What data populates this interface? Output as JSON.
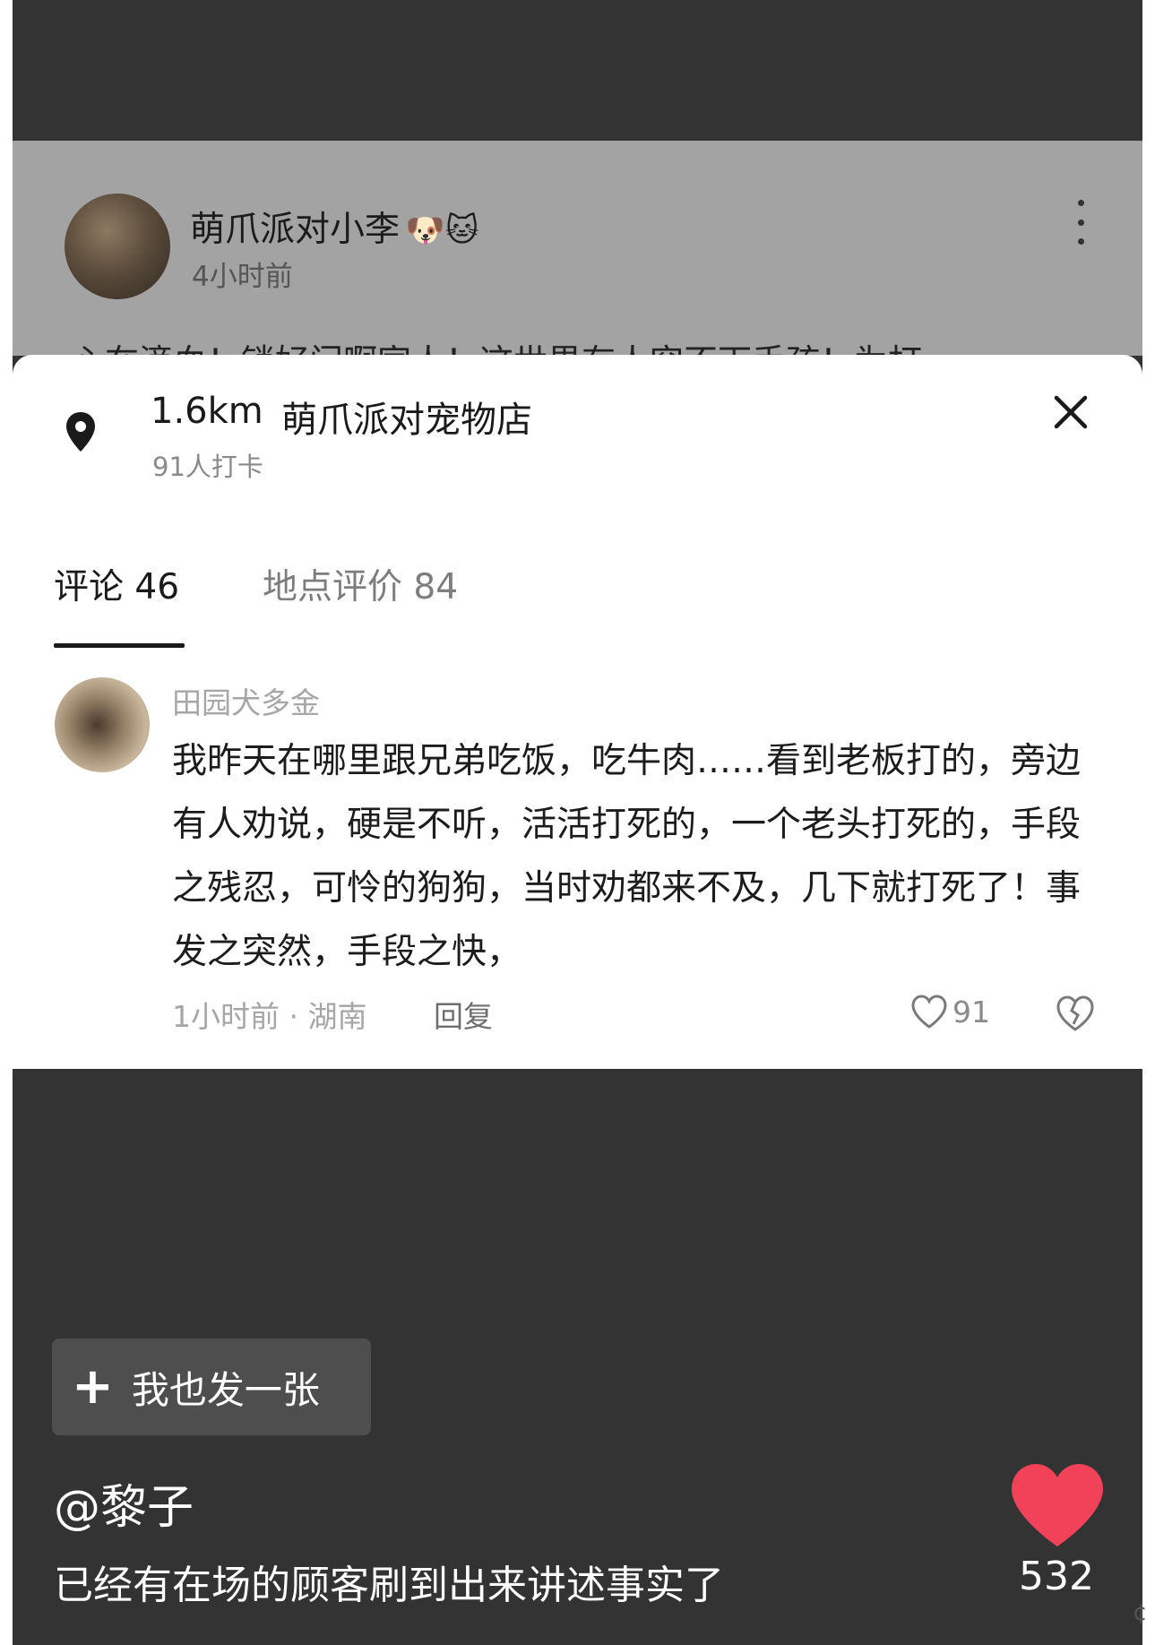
{
  "post": {
    "author": "萌爪派对小李",
    "author_emojis": "🐶🐱",
    "time": "4小时前",
    "text_partial": "心在滴血！锁好门啊家人！这世界有人突不下手孩！为打"
  },
  "location_sheet": {
    "distance": "1.6km",
    "name": "萌爪派对宠物店",
    "checkins": "91人打卡"
  },
  "tabs": [
    {
      "label": "评论 46"
    },
    {
      "label": "地点评价 84"
    }
  ],
  "comment": {
    "username": "田园犬多金",
    "text": "我昨天在哪里跟兄弟吃饭，吃牛肉……看到老板打的，旁边有人劝说，硬是不听，活活打死的，一个老头打死的，手段之残忍，可怜的狗狗，当时劝都来不及，几下就打死了！事发之突然，手段之快，",
    "meta": "1小时前 · 湖南",
    "reply_label": "回复",
    "like_count": "91"
  },
  "bottom": {
    "post_button_label": "我也发一张",
    "username": "@黎子",
    "caption": "已经有在场的顾客刷到出来讲述事实了",
    "like_count": "532"
  },
  "colors": {
    "background": "#333333",
    "dimmed_post": "#a3a3a3",
    "sheet": "#ffffff",
    "heart": "#f1425a"
  },
  "icons": {
    "location": "location-pin-icon",
    "close": "close-icon",
    "like": "heart-outline-icon",
    "dislike": "broken-heart-icon",
    "add": "plus-icon",
    "big_like": "heart-filled-icon",
    "more": "more-vertical-icon"
  }
}
